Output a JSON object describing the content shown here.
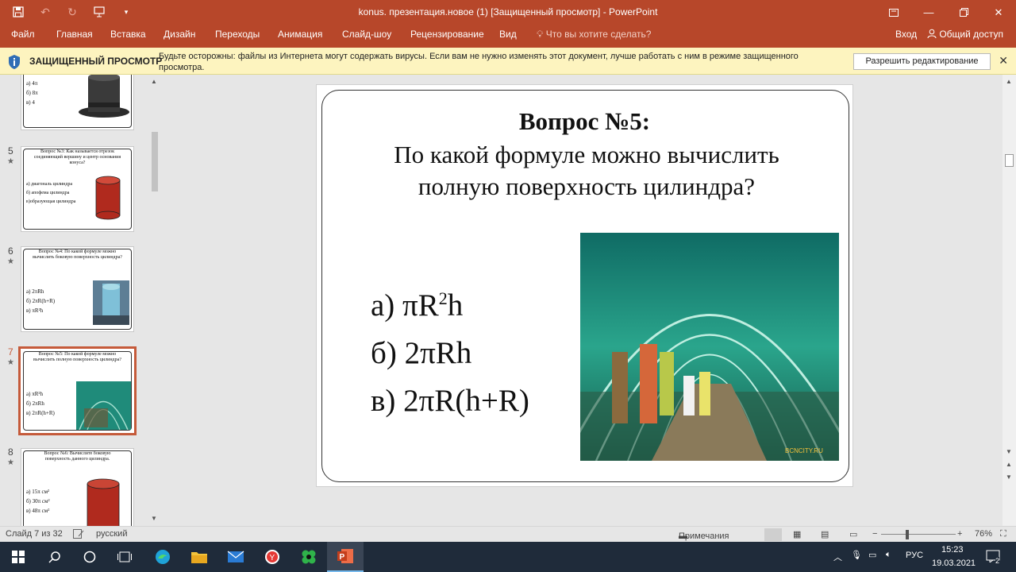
{
  "window": {
    "title": "konus. презентация.новое (1) [Защищенный просмотр] - PowerPoint",
    "accent": "#b7472a"
  },
  "qat": {
    "save_icon": "save-icon",
    "undo_icon": "undo-icon",
    "redo_icon": "redo-icon",
    "present_icon": "start-from-beginning-icon",
    "customize_icon": "customize-qat-icon"
  },
  "ribbon": {
    "tabs": [
      "Файл",
      "Главная",
      "Вставка",
      "Дизайн",
      "Переходы",
      "Анимация",
      "Слайд-шоу",
      "Рецензирование",
      "Вид"
    ],
    "tell_me": "Что вы хотите сделать?",
    "sign_in": "Вход",
    "share": "Общий доступ"
  },
  "protected_view": {
    "title": "ЗАЩИЩЕННЫЙ ПРОСМОТР",
    "message": "Будьте осторожны: файлы из Интернета могут содержать вирусы. Если вам не нужно изменять этот документ, лучше работать с ним в режиме защищенного просмотра.",
    "enable_button": "Разрешить редактирование"
  },
  "thumbnails": [
    {
      "answers": [
        "а) 4π",
        "б) 8π",
        "в) 4"
      ]
    },
    {
      "number": "5",
      "question": "Вопрос №3: Как называется отрезок соединяющий вершину и центр основания конуса?",
      "answers": [
        "а) диагональ цилиндра",
        "б) апофема цилиндра",
        "в)образующая цилиндра"
      ]
    },
    {
      "number": "6",
      "question": "Вопрос №4: По какой формуле можно вычислить боковую поверхность цилиндра?",
      "answers": [
        "а) 2πRh",
        "б) 2πR(h+R)",
        "в) πR²h"
      ]
    },
    {
      "number": "7",
      "question": "Вопрос №5: По какой формуле можно вычислить полную поверхность цилиндра?",
      "answers": [
        "а) πR²h",
        "б) 2πRh",
        "в) 2πR(h+R)"
      ]
    },
    {
      "number": "8",
      "question": "Вопрос №6: Вычислите боковую поверхность данного цилиндра.",
      "answers": [
        "а) 15π см²",
        "б) 30π см²",
        "в) 48π см²"
      ]
    }
  ],
  "slide": {
    "title": "Вопрос №5:",
    "question": "По какой формуле можно вычислить полную поверхность цилиндра?",
    "answers": [
      {
        "prefix": "а) πR",
        "sup": "2",
        "suffix": "h"
      },
      {
        "prefix": "б) 2πRh",
        "sup": "",
        "suffix": ""
      },
      {
        "prefix": "в) 2πR(h+R)",
        "sup": "",
        "suffix": ""
      }
    ],
    "photo_watermark": "BCNCITY.RU"
  },
  "status": {
    "slide_info": "Слайд 7 из 32",
    "language": "русский",
    "notes": "Примечания",
    "zoom": "76%"
  },
  "taskbar": {
    "lang": "РУС",
    "time": "15:23",
    "date": "19.03.2021",
    "notifications": "2"
  }
}
